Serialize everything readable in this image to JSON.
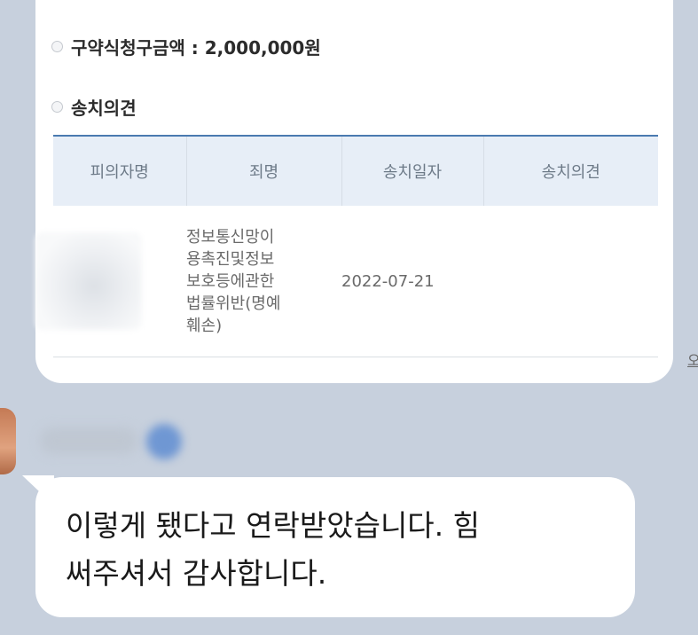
{
  "document_card": {
    "claim_line": "구약식청구금액 : 2,000,000원",
    "opinion_heading": "송치의견",
    "table": {
      "headers": [
        "피의자명",
        "죄명",
        "송치일자",
        "송치의견"
      ],
      "rows": [
        {
          "suspect": "",
          "crime": "정보통신망이\n용촉진및정보\n보호등에관한\n법률위반(명예\n훼손)",
          "date": "2022-07-21",
          "opinion": ""
        }
      ]
    }
  },
  "side_link": "오",
  "message": {
    "text": "이렇게 됐다고 연락받았습니다. 힘\n써주셔서 감사합니다."
  }
}
